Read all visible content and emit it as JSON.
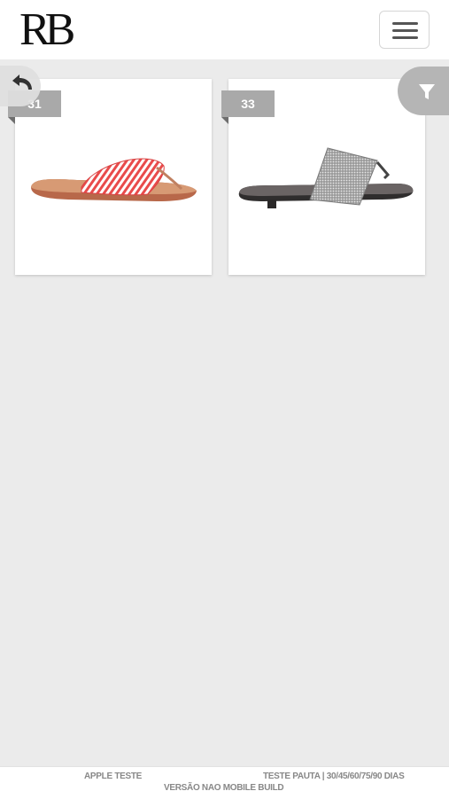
{
  "header": {
    "logo_text": "RB",
    "menu_icon": "hamburger-icon"
  },
  "actions": {
    "back_icon": "undo-arrow-icon",
    "filter_icon": "funnel-filter-icon"
  },
  "products": [
    {
      "badge": "31",
      "image": "red-white-striped-flip-flop-sandal"
    },
    {
      "badge": "33",
      "image": "silver-glitter-band-flat-sandal"
    }
  ],
  "footer": {
    "left": "APPLE TESTE",
    "right": "TESTE PAUTA | 30/45/60/75/90 DIAS",
    "center": "VERSÃO NAO MOBILE BUILD"
  },
  "colors": {
    "background": "#ebebeb",
    "badge": "#a9a9a9",
    "filter_button": "#b5b5b5"
  }
}
